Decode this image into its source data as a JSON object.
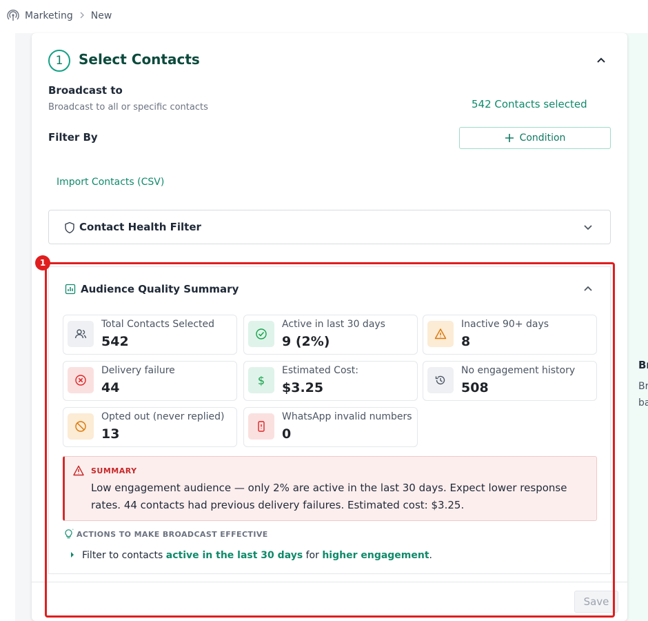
{
  "breadcrumb": {
    "items": [
      "Marketing",
      "New"
    ]
  },
  "step": {
    "number": "1",
    "title": "Select Contacts"
  },
  "broadcast": {
    "title": "Broadcast to",
    "subtitle": "Broadcast to all or specific contacts",
    "selected_text": "542 Contacts selected"
  },
  "filter": {
    "title": "Filter By",
    "condition_button": "Condition",
    "import_link": "Import Contacts (CSV)"
  },
  "health_filter": {
    "title": "Contact Health Filter"
  },
  "audience": {
    "title": "Audience Quality Summary",
    "stats": [
      {
        "label": "Total Contacts Selected",
        "value": "542",
        "icon": "users-icon",
        "tone": "gray"
      },
      {
        "label": "Active in last 30 days",
        "value": "9 (2%)",
        "icon": "check-circle-icon",
        "tone": "green"
      },
      {
        "label": "Inactive 90+ days",
        "value": "8",
        "icon": "warning-icon",
        "tone": "amber"
      },
      {
        "label": "Delivery failure",
        "value": "44",
        "icon": "x-circle-icon",
        "tone": "red"
      },
      {
        "label": "Estimated Cost:",
        "value": "$3.25",
        "icon": "dollar-icon",
        "tone": "green"
      },
      {
        "label": "No engagement history",
        "value": "508",
        "icon": "history-icon",
        "tone": "gray"
      },
      {
        "label": "Opted out (never replied)",
        "value": "13",
        "icon": "ban-icon",
        "tone": "amber"
      },
      {
        "label": "WhatsApp invalid numbers",
        "value": "0",
        "icon": "phone-icon",
        "tone": "red"
      }
    ],
    "summary": {
      "heading": "SUMMARY",
      "body": "Low engagement audience — only 2% are active in the last 30 days. Expect lower response rates. 44 contacts had previous delivery failures. Estimated cost: $3.25."
    },
    "actions": {
      "heading": "ACTIONS TO MAKE BROADCAST EFFECTIVE",
      "item": {
        "prefix": "Filter to contacts ",
        "highlight1": "active in the last 30 days",
        "middle": " for ",
        "highlight2": "higher engagement",
        "suffix": "."
      }
    }
  },
  "save_label": "Save",
  "annotation_badge": "1",
  "right_panel": {
    "line1": "Br",
    "line2": "Br",
    "line3": "ba"
  },
  "colors": {
    "accent": "#0f8a6a",
    "highlight": "#e01e1e",
    "summary_bg": "#fdeeee"
  }
}
